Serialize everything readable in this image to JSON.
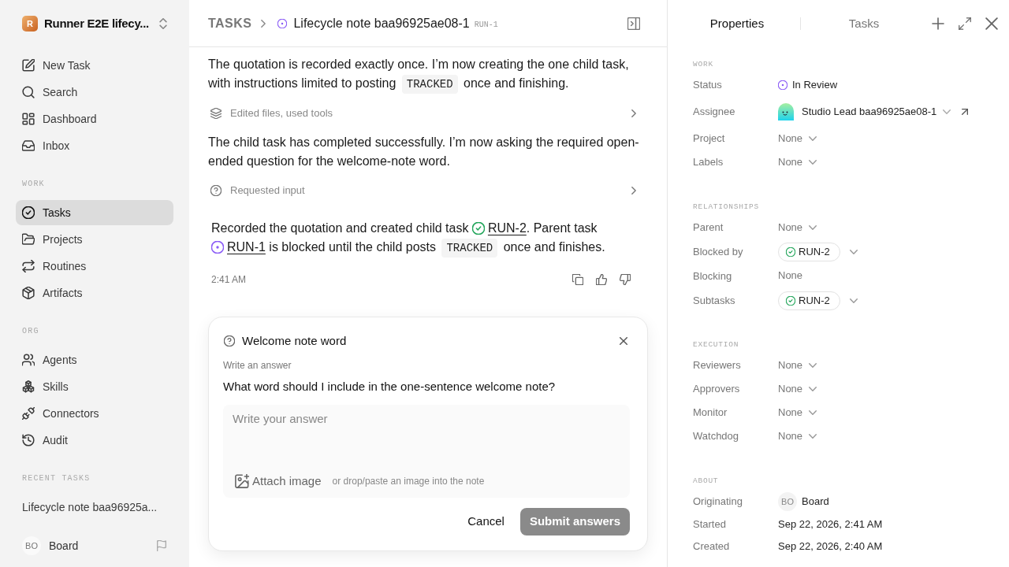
{
  "sidebar": {
    "workspace": {
      "initial": "R",
      "name": "Runner E2E lifecy..."
    },
    "sections": [
      {
        "kind": "nav",
        "items": [
          {
            "label": "New Task",
            "selected": false
          },
          {
            "label": "Search",
            "selected": false
          },
          {
            "label": "Dashboard",
            "selected": false
          },
          {
            "label": "Inbox",
            "selected": false
          }
        ]
      },
      {
        "kind": "nav",
        "heading": "WORK",
        "items": [
          {
            "label": "Tasks",
            "selected": true
          },
          {
            "label": "Projects",
            "selected": false
          },
          {
            "label": "Routines",
            "selected": false
          },
          {
            "label": "Artifacts",
            "selected": false
          }
        ]
      },
      {
        "kind": "nav",
        "heading": "ORG",
        "items": [
          {
            "label": "Agents",
            "selected": false
          },
          {
            "label": "Skills",
            "selected": false
          },
          {
            "label": "Connectors",
            "selected": false
          },
          {
            "label": "Audit",
            "selected": false
          }
        ]
      },
      {
        "kind": "recent",
        "heading": "RECENT TASKS",
        "items": [
          {
            "label": "Lifecycle note baa96925a...",
            "selected": false
          }
        ]
      }
    ],
    "user": {
      "initials": "BO",
      "name": "Board"
    }
  },
  "main": {
    "breadcrumb": {
      "section": "TASKS",
      "title": "Lifecycle note baa96925ae08-1",
      "id": "RUN-1",
      "done": false
    },
    "thread": [
      {
        "kind": "message",
        "parts": [
          {
            "kind": "text",
            "text": "The quotation is recorded exactly once. I’m now creating the one child task, with instructions limited to posting "
          },
          {
            "kind": "code",
            "text": "TRACKED"
          },
          {
            "kind": "text",
            "text": " once and finishing."
          }
        ]
      },
      {
        "kind": "tools",
        "label": "Edited files, used tools"
      },
      {
        "kind": "message",
        "parts": [
          {
            "kind": "text",
            "text": "The child task has completed successfully. I’m now asking the required open-ended question for the welcome-note word."
          }
        ]
      },
      {
        "kind": "input_request",
        "label": "Requested input"
      },
      {
        "kind": "reply",
        "time": "2:41 AM",
        "parts": [
          {
            "kind": "text",
            "text": "Recorded the quotation and created child task "
          },
          {
            "kind": "task_link",
            "id": "RUN-2",
            "done": true
          },
          {
            "kind": "text",
            "text": ". Parent task "
          },
          {
            "kind": "task_link",
            "id": "RUN-1",
            "done": false
          },
          {
            "kind": "text",
            "text": " is blocked until the child posts "
          },
          {
            "kind": "code",
            "text": "TRACKED"
          },
          {
            "kind": "text",
            "text": " once and finishes."
          }
        ]
      }
    ],
    "question_card": {
      "title": "Welcome note word",
      "mode": "Write an answer",
      "question": "What word should I include in the one-sentence welcome note?",
      "answer": {
        "placeholder": "Write your answer"
      },
      "attach": {
        "label": "Attach image",
        "hint": "or drop/paste an image into the note"
      },
      "buttons": [
        {
          "label": "Cancel",
          "kind": "secondary",
          "disabled": false
        },
        {
          "label": "Submit answers",
          "kind": "primary",
          "disabled": true
        }
      ]
    }
  },
  "properties": {
    "tabs": [
      {
        "label": "Properties",
        "selected": true
      },
      {
        "label": "Tasks",
        "selected": false
      }
    ],
    "sections": [
      {
        "heading": "WORK",
        "rows": [
          {
            "label": "Status",
            "kind": "status",
            "value": "In Review",
            "done": false
          },
          {
            "label": "Assignee",
            "kind": "agent",
            "value": "Studio Lead baa96925ae08-1"
          },
          {
            "label": "Project",
            "kind": "select",
            "value": "None"
          },
          {
            "label": "Labels",
            "kind": "select",
            "value": "None"
          }
        ]
      },
      {
        "heading": "RELATIONSHIPS",
        "rows": [
          {
            "label": "Parent",
            "kind": "select",
            "value": "None"
          },
          {
            "label": "Blocked by",
            "kind": "task_pills",
            "tasks": [
              {
                "id": "RUN-2",
                "done": true
              }
            ]
          },
          {
            "label": "Blocking",
            "kind": "text",
            "value": "None"
          },
          {
            "label": "Subtasks",
            "kind": "task_pills",
            "tasks": [
              {
                "id": "RUN-2",
                "done": true
              }
            ]
          }
        ]
      },
      {
        "heading": "EXECUTION",
        "rows": [
          {
            "label": "Reviewers",
            "kind": "select",
            "value": "None"
          },
          {
            "label": "Approvers",
            "kind": "select",
            "value": "None"
          },
          {
            "label": "Monitor",
            "kind": "select",
            "value": "None"
          },
          {
            "label": "Watchdog",
            "kind": "select",
            "value": "None"
          }
        ]
      },
      {
        "heading": "ABOUT",
        "rows": [
          {
            "label": "Originating",
            "kind": "user",
            "initials": "BO",
            "value": "Board"
          },
          {
            "label": "Started",
            "kind": "date",
            "value": "Sep 22, 2026, 2:41 AM"
          },
          {
            "label": "Created",
            "kind": "date",
            "value": "Sep 22, 2026, 2:40 AM"
          }
        ]
      }
    ]
  }
}
